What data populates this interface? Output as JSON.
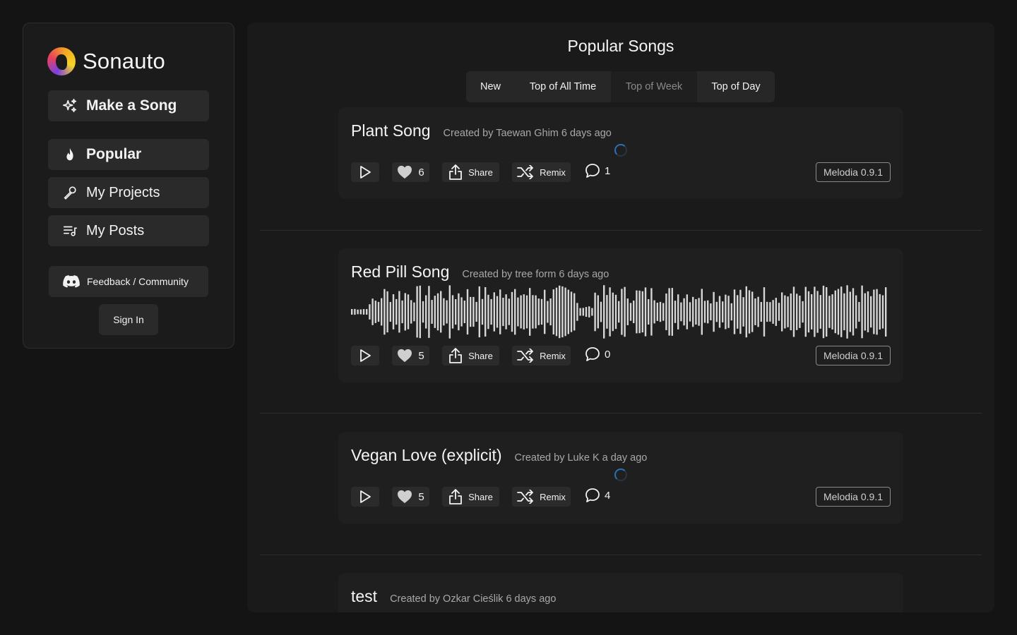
{
  "sidebar": {
    "brand": "Sonauto",
    "make_song": "Make a Song",
    "nav": [
      {
        "label": "Popular",
        "icon": "flame-icon"
      },
      {
        "label": "My Projects",
        "icon": "microphone-icon"
      },
      {
        "label": "My Posts",
        "icon": "playlist-icon"
      }
    ],
    "feedback": "Feedback / Community",
    "sign_in": "Sign In"
  },
  "main": {
    "title": "Popular Songs",
    "tabs": [
      {
        "label": "New",
        "active": false
      },
      {
        "label": "Top of All Time",
        "active": false
      },
      {
        "label": "Top of Week",
        "active": true
      },
      {
        "label": "Top of Day",
        "active": false
      }
    ],
    "share_label": "Share",
    "remix_label": "Remix",
    "songs": [
      {
        "title": "Plant Song",
        "meta": "Created by Taewan Ghim 6 days ago",
        "likes": "6",
        "comments": "1",
        "model": "Melodia 0.9.1",
        "loading": true
      },
      {
        "title": "Red Pill Song",
        "meta": "Created by tree form 6 days ago",
        "likes": "5",
        "comments": "0",
        "model": "Melodia 0.9.1",
        "loading": false
      },
      {
        "title": "Vegan Love (explicit)",
        "meta": "Created by Luke K a day ago",
        "likes": "5",
        "comments": "4",
        "model": "Melodia 0.9.1",
        "loading": true
      },
      {
        "title": "test",
        "meta": "Created by Ozkar Cieślik 6 days ago"
      }
    ]
  },
  "colors": {
    "background": "#141414",
    "panel": "#1b1b1b",
    "card": "#1f1f1f",
    "button": "#2a2a2a",
    "spinner": "#2f6fb8"
  }
}
